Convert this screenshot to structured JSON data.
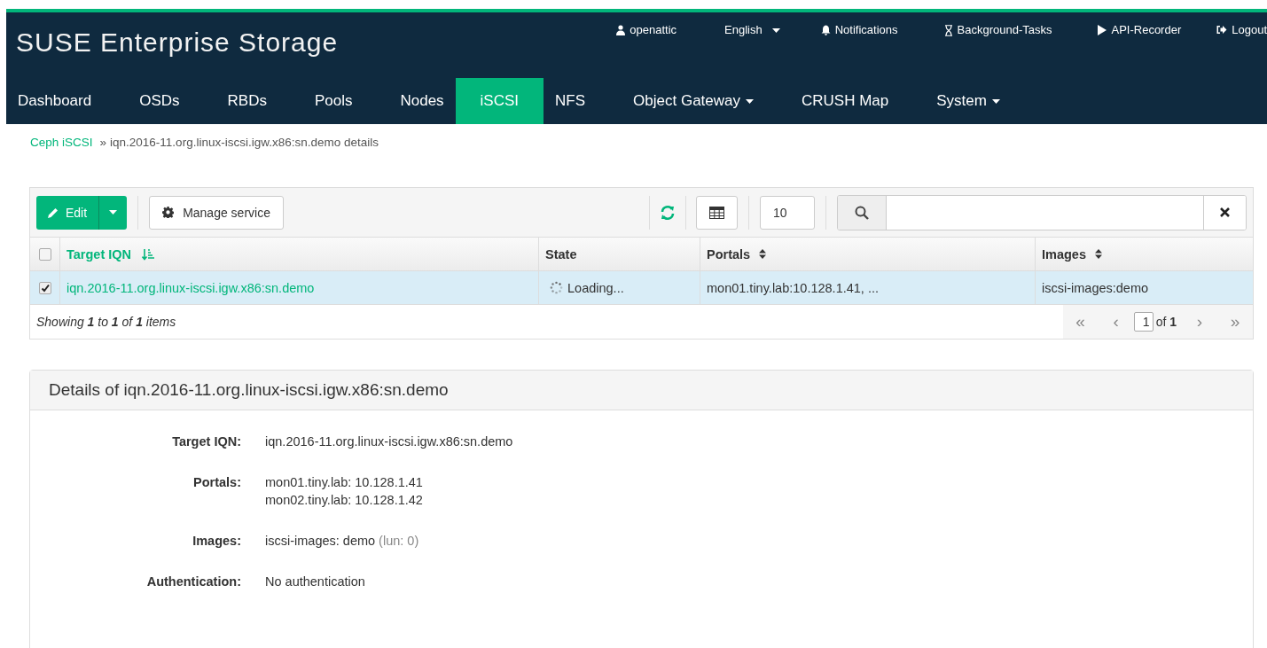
{
  "header": {
    "brand": "SUSE Enterprise Storage",
    "links": [
      {
        "kind": "user",
        "label": "openattic",
        "dropdown": false
      },
      {
        "kind": "language",
        "label": "English",
        "dropdown": true
      },
      {
        "kind": "bell",
        "label": "Notifications",
        "dropdown": false
      },
      {
        "kind": "hourglass",
        "label": "Background-Tasks",
        "dropdown": false
      },
      {
        "kind": "play",
        "label": "API-Recorder",
        "dropdown": false
      },
      {
        "kind": "logout",
        "label": "Logout",
        "dropdown": false
      }
    ],
    "nav": [
      {
        "label": "Dashboard",
        "selected": false,
        "dropdown": false
      },
      {
        "label": "OSDs",
        "selected": false,
        "dropdown": false
      },
      {
        "label": "RBDs",
        "selected": false,
        "dropdown": false
      },
      {
        "label": "Pools",
        "selected": false,
        "dropdown": false
      },
      {
        "label": "Nodes",
        "selected": false,
        "dropdown": false
      },
      {
        "label": "iSCSI",
        "selected": true,
        "dropdown": false
      },
      {
        "label": "NFS",
        "selected": false,
        "dropdown": false
      },
      {
        "label": "Object Gateway",
        "selected": false,
        "dropdown": true
      },
      {
        "label": "CRUSH Map",
        "selected": false,
        "dropdown": false
      },
      {
        "label": "System",
        "selected": false,
        "dropdown": true
      }
    ]
  },
  "breadcrumb": {
    "link": "Ceph iSCSI",
    "separator": "»",
    "current": "iqn.2016-11.org.linux-iscsi.igw.x86:sn.demo details"
  },
  "table": {
    "toolbar": {
      "edit": "Edit",
      "manage": "Manage service",
      "page_size": "10"
    },
    "all_checked": false,
    "columns": [
      {
        "label": "Target IQN",
        "sortable": true,
        "sorted": true
      },
      {
        "label": "State",
        "sortable": false,
        "sorted": false
      },
      {
        "label": "Portals",
        "sortable": true,
        "sorted": false
      },
      {
        "label": "Images",
        "sortable": true,
        "sorted": false
      }
    ],
    "rows": [
      {
        "selected": true,
        "cells": [
          "iqn.2016-11.org.linux-iscsi.igw.x86:sn.demo",
          "Loading...",
          "mon01.tiny.lab:10.128.1.41, ...",
          "iscsi-images:demo"
        ]
      }
    ],
    "footer": "Showing **1** to **1** of **1** items",
    "pagination": {
      "first": "«",
      "prev": "‹",
      "page": "1",
      "of": "of **1**",
      "next": "›",
      "last": "»"
    }
  },
  "details": {
    "title": "Details of iqn.2016-11.org.linux-iscsi.igw.x86:sn.demo",
    "fields": [
      {
        "label": "Target IQN:",
        "values": [
          {
            "text": "iqn.2016-11.org.linux-iscsi.igw.x86:sn.demo"
          }
        ]
      },
      {
        "label": "Portals:",
        "values": [
          {
            "text": "mon01.tiny.lab: 10.128.1.41"
          },
          {
            "text": "mon02.tiny.lab: 10.128.1.42"
          }
        ]
      },
      {
        "label": "Images:",
        "values": [
          {
            "text": "iscsi-images: demo",
            "note": "(lun: 0)"
          }
        ]
      },
      {
        "label": "Authentication:",
        "values": [
          {
            "text": "No authentication"
          }
        ]
      }
    ]
  }
}
